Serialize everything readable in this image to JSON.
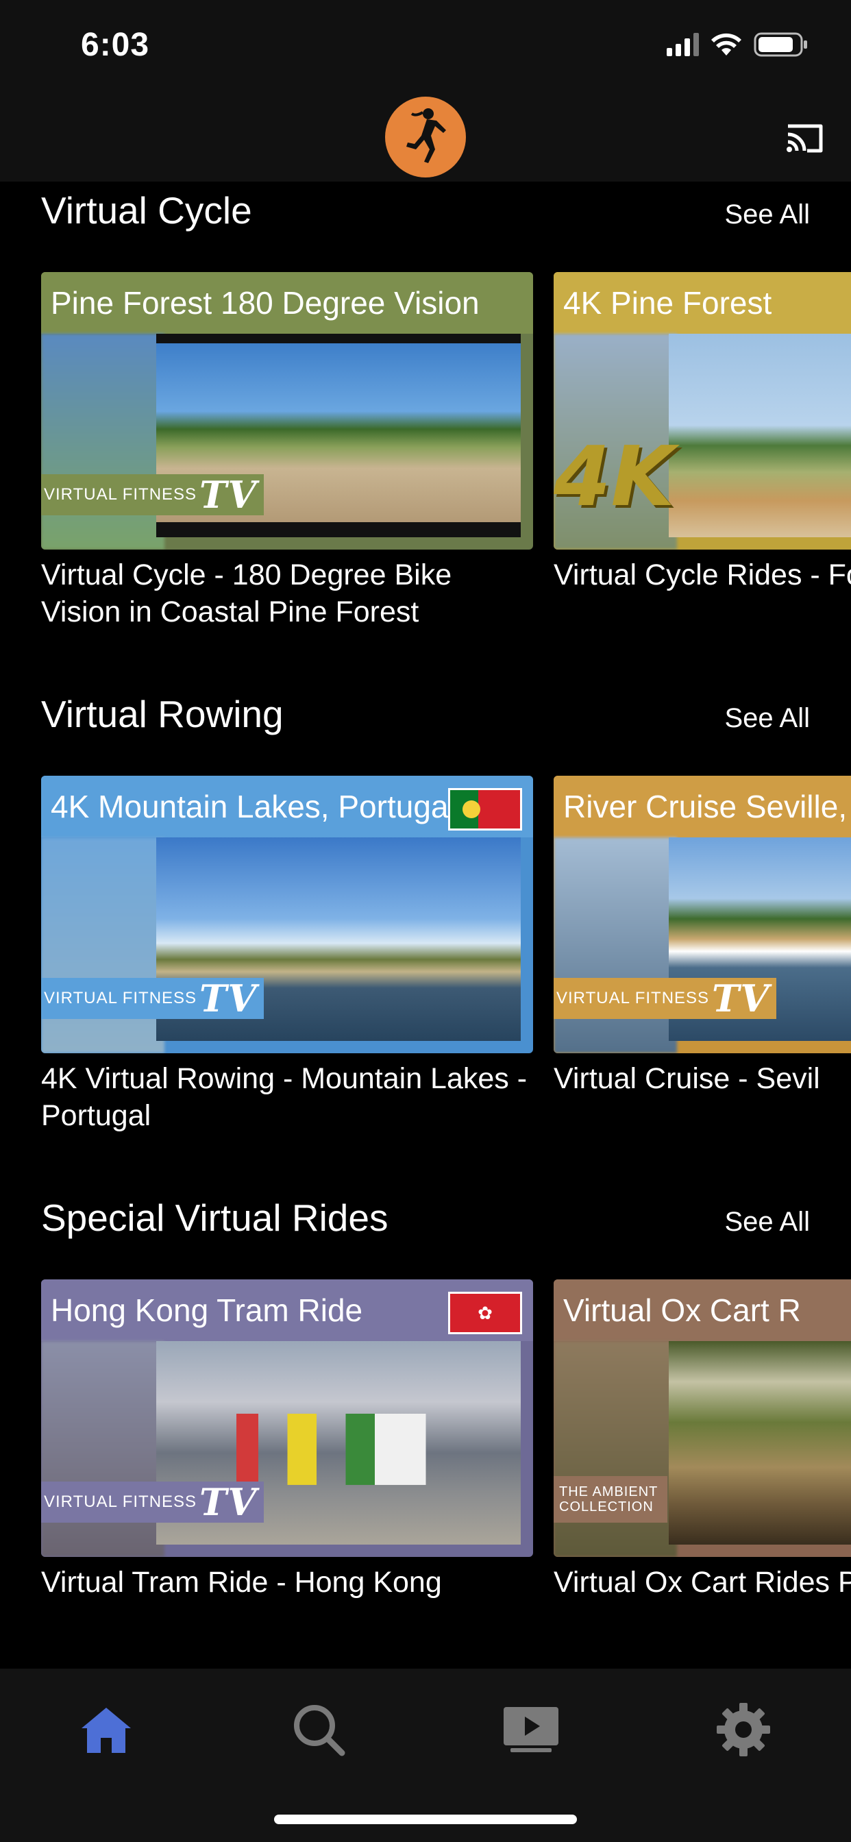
{
  "status": {
    "time": "6:03"
  },
  "sections": [
    {
      "title": "Virtual Cycle",
      "see_all": "See All",
      "cards": [
        {
          "banner": "Pine Forest 180 Degree Vision",
          "title": "Virtual Cycle - 180 Degree Bike Vision in Coastal Pine Forest",
          "badge": "VIRTUAL FITNESS",
          "badge_tv": "TV"
        },
        {
          "banner": "4K Pine Forest",
          "title": "Virtual Cycle Rides - Forest",
          "overlay": "4K"
        }
      ]
    },
    {
      "title": "Virtual Rowing",
      "see_all": "See All",
      "cards": [
        {
          "banner": "4K Mountain Lakes, Portugal",
          "title": "4K Virtual Rowing - Mountain Lakes - Portugal",
          "badge": "VIRTUAL FITNESS",
          "badge_tv": "TV"
        },
        {
          "banner": "River Cruise Seville, S",
          "title": "Virtual Cruise - Sevil",
          "badge": "VIRTUAL FITNESS",
          "badge_tv": "TV"
        }
      ]
    },
    {
      "title": "Special Virtual Rides",
      "see_all": "See All",
      "cards": [
        {
          "banner": "Hong Kong Tram Ride",
          "title": "Virtual Tram Ride - Hong Kong",
          "badge": "VIRTUAL FITNESS",
          "badge_tv": "TV"
        },
        {
          "banner": "Virtual Ox Cart R",
          "title": "Virtual Ox Cart Rides Philippines",
          "badge": "THE AMBIENT COLLECTION"
        }
      ]
    }
  ],
  "tabs": [
    {
      "icon": "home-icon",
      "active": true
    },
    {
      "icon": "search-icon",
      "active": false
    },
    {
      "icon": "play-video-icon",
      "active": false
    },
    {
      "icon": "gear-icon",
      "active": false
    }
  ],
  "colors": {
    "background": "#000000",
    "header": "#111111",
    "tab_bar": "#131313",
    "accent_active_tab": "#4d6fd6",
    "inactive_tab": "#7a7a7a",
    "logo_orange": "#e6843a"
  }
}
